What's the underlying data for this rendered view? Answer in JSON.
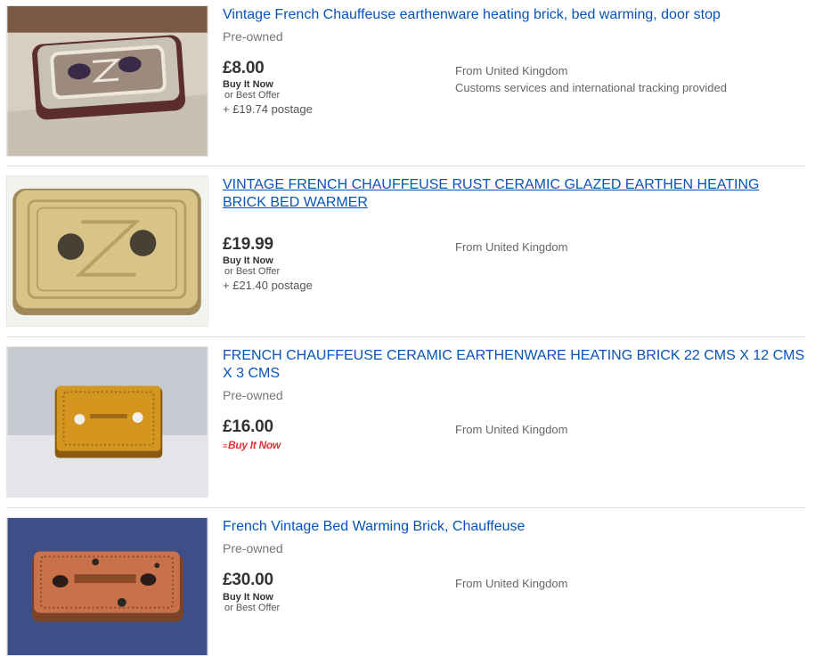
{
  "listings": [
    {
      "title": "Vintage French Chauffeuse earthenware heating brick, bed warming, door stop",
      "condition": "Pre-owned",
      "price": "£8.00",
      "buy_it_now": "Buy It Now",
      "best_offer": "or Best Offer",
      "postage": "+ £19.74 postage",
      "from": "From United Kingdom",
      "customs": "Customs services and international tracking provided"
    },
    {
      "title": "VINTAGE FRENCH CHAUFFEUSE RUST CERAMIC GLAZED EARTHEN HEATING BRICK BED WARMER",
      "price": "£19.99",
      "buy_it_now": "Buy It Now",
      "best_offer": "or Best Offer",
      "postage": "+ £21.40 postage",
      "from": "From United Kingdom"
    },
    {
      "title": "FRENCH CHAUFFEUSE CERAMIC EARTHENWARE HEATING BRICK 22 CMS X 12 CMS X 3 CMS",
      "condition": "Pre-owned",
      "price": "£16.00",
      "buy_it_now_logo": "Buy It Now",
      "from": "From United Kingdom"
    },
    {
      "title": "French Vintage Bed Warming Brick, Chauffeuse",
      "condition": "Pre-owned",
      "price": "£30.00",
      "buy_it_now": "Buy It Now",
      "best_offer": "or Best Offer",
      "from": "From United Kingdom"
    }
  ],
  "colors": {
    "link": "#0654ba",
    "muted": "#767676",
    "buy_it_now_red": "#e53238",
    "divider": "#dddddd"
  }
}
